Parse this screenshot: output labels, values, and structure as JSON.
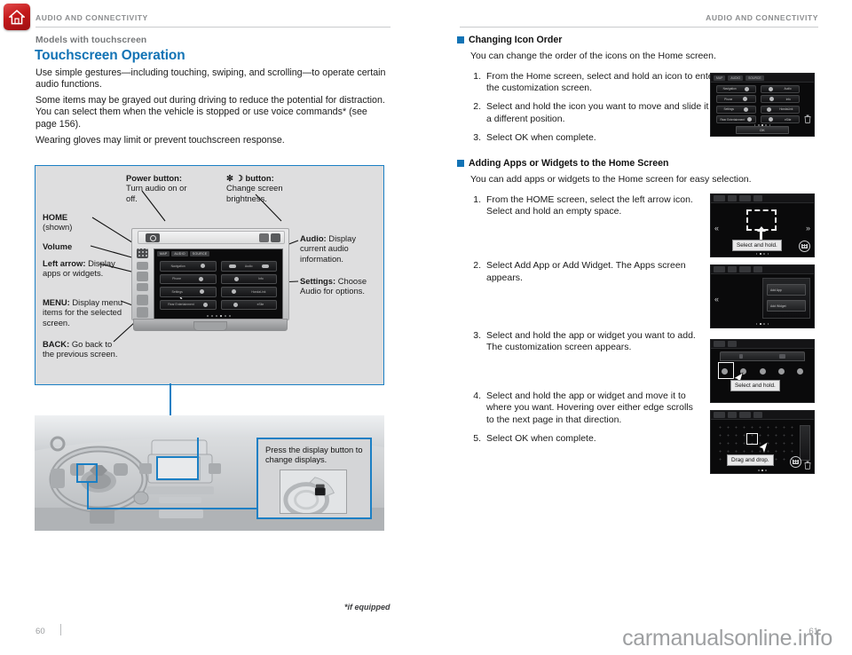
{
  "home_tab": {
    "icon": "home-icon"
  },
  "left_page": {
    "running_head": "AUDIO AND CONNECTIVITY",
    "models_line": "Models with touchscreen",
    "section_title": "Touchscreen Operation",
    "paragraphs": [
      "Use simple gestures—including touching, swiping, and scrolling—to operate certain audio functions.",
      "Some items may be grayed out during driving to reduce the potential for distraction. You can select them when the vehicle is stopped or use voice commands* (see page 156).",
      "Wearing gloves may limit or prevent touchscreen response."
    ],
    "figure": {
      "callouts": [
        {
          "label": "Power button:",
          "text": "Turn audio on or off."
        },
        {
          "label": "✻ ☽ button:",
          "text": "Change screen brightness."
        },
        {
          "label": "HOME",
          "text": "(shown)"
        },
        {
          "label": "Volume",
          "text": ""
        },
        {
          "label": "Left arrow:",
          "text": "Display apps or widgets."
        },
        {
          "label": "MENU:",
          "text": "Display menu items for the selected screen."
        },
        {
          "label": "BACK:",
          "text": "Go back to the previous screen."
        },
        {
          "label": "Audio:",
          "text": "Display current audio information."
        },
        {
          "label": "Settings:",
          "text": "Choose Audio for options."
        }
      ],
      "head_unit": {
        "tabs": [
          "MAP",
          "AUDIO",
          "SOURCE"
        ],
        "left_column": [
          "Navigation",
          "Phone",
          "Settings",
          "Rear Entertainment"
        ],
        "right_column": [
          "Audio",
          "Info",
          "HondaLink",
          "eSite"
        ]
      }
    },
    "photo": {
      "inset_text": "Press the display button to change displays.",
      "inset_image": "steering-wheel-control-image"
    },
    "footnote": "*if equipped",
    "page_number": "60"
  },
  "right_page": {
    "running_head": "AUDIO AND CONNECTIVITY",
    "sections": [
      {
        "heading": "Changing Icon Order",
        "intro": "You can change the order of the icons on the Home screen.",
        "steps": [
          {
            "num": "1.",
            "text": "From the Home screen, select and hold an icon to enter the customization screen."
          },
          {
            "num": "2.",
            "text": "Select and hold the icon you want to move and slide it to a different position."
          },
          {
            "num": "3.",
            "text": "Select OK when complete."
          }
        ]
      },
      {
        "heading": "Adding Apps or Widgets to the Home Screen",
        "intro": "You can add apps or widgets to the Home screen for easy selection.",
        "steps": [
          {
            "num": "1.",
            "text": "From the HOME screen, select the left arrow icon. Select and hold an empty space."
          },
          {
            "num": "2.",
            "text": "Select Add App or Add Widget. The Apps screen appears."
          },
          {
            "num": "3.",
            "text": "Select and hold the app or widget you want to add. The customization screen appears."
          },
          {
            "num": "4.",
            "text": "Select and hold the app or widget and move it to where you want. Hovering over either edge scrolls to the next page in that direction."
          },
          {
            "num": "5.",
            "text": "Select OK when complete."
          }
        ]
      }
    ],
    "screenshots": {
      "icon_order": {
        "tabs": [
          "MAP",
          "AUDIO",
          "SOURCE"
        ],
        "left_column": [
          "Navigation",
          "Phone",
          "Settings",
          "Rear Entertainment"
        ],
        "right_column": [
          "Audio",
          "Info",
          "HondaLink",
          "eSite"
        ],
        "ok_label": "OK",
        "trash": "trash-icon"
      },
      "add_step1": {
        "tip": "Select and hold."
      },
      "add_step2": {
        "rows": [
          "Add App",
          "Add Widget"
        ]
      },
      "add_step3": {
        "tip": "Select and hold."
      },
      "add_step4": {
        "tip": "Drag and drop."
      }
    },
    "page_number": "61"
  },
  "watermark": "carmanualsonline.info",
  "colors": {
    "accent_blue": "#1273b5",
    "rule_blue": "#1b7fc4",
    "head_gray": "#8b8d8f",
    "tab_red": "#c4191b"
  }
}
